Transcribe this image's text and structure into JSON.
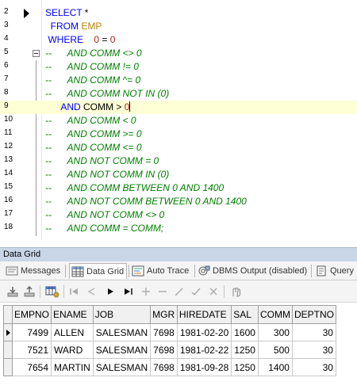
{
  "editor": {
    "current_line": 9,
    "lines": [
      {
        "n": "2",
        "tokens": [
          {
            "t": "SELECT",
            "c": "kw"
          },
          {
            "t": " *",
            "c": "id"
          }
        ]
      },
      {
        "n": "3",
        "tokens": [
          {
            "t": "  FROM ",
            "c": "kw"
          },
          {
            "t": "EMP",
            "c": "tbl"
          }
        ]
      },
      {
        "n": "4",
        "tokens": [
          {
            "t": " WHERE",
            "c": "kw"
          },
          {
            "t": "    ",
            "c": "id"
          },
          {
            "t": "0",
            "c": "num"
          },
          {
            "t": " = ",
            "c": "id"
          },
          {
            "t": "0",
            "c": "num"
          }
        ]
      },
      {
        "n": "5",
        "tokens": [
          {
            "t": "--      AND COMM <> 0",
            "c": "cm"
          }
        ]
      },
      {
        "n": "6",
        "tokens": [
          {
            "t": "--      AND COMM != 0",
            "c": "cm"
          }
        ]
      },
      {
        "n": "7",
        "tokens": [
          {
            "t": "--      AND COMM ^= 0",
            "c": "cm"
          }
        ]
      },
      {
        "n": "8",
        "tokens": [
          {
            "t": "--      AND COMM NOT IN (0)",
            "c": "cm"
          }
        ]
      },
      {
        "n": "9",
        "tokens": [
          {
            "t": "      AND ",
            "c": "kw"
          },
          {
            "t": "COMM > ",
            "c": "id"
          },
          {
            "t": "0",
            "c": "num"
          }
        ]
      },
      {
        "n": "10",
        "tokens": [
          {
            "t": "--      AND COMM < 0",
            "c": "cm"
          }
        ]
      },
      {
        "n": "11",
        "tokens": [
          {
            "t": "--      AND COMM >= 0",
            "c": "cm"
          }
        ]
      },
      {
        "n": "12",
        "tokens": [
          {
            "t": "--      AND COMM <= 0",
            "c": "cm"
          }
        ]
      },
      {
        "n": "13",
        "tokens": [
          {
            "t": "--      AND NOT COMM = 0",
            "c": "cm"
          }
        ]
      },
      {
        "n": "14",
        "tokens": [
          {
            "t": "--      AND NOT COMM IN (0)",
            "c": "cm"
          }
        ]
      },
      {
        "n": "15",
        "tokens": [
          {
            "t": "--      AND COMM BETWEEN 0 AND 1400",
            "c": "cm"
          }
        ]
      },
      {
        "n": "16",
        "tokens": [
          {
            "t": "--      AND NOT COMM BETWEEN 0 AND 1400",
            "c": "cm"
          }
        ]
      },
      {
        "n": "17",
        "tokens": [
          {
            "t": "--      AND NOT COMM <> 0",
            "c": "cm"
          }
        ]
      },
      {
        "n": "18",
        "tokens": [
          {
            "t": "--      AND COMM = COMM;",
            "c": "cm"
          }
        ]
      }
    ]
  },
  "panel": {
    "title": "Data Grid"
  },
  "tabs": [
    {
      "label": "Messages",
      "icon": "messages-icon",
      "active": false
    },
    {
      "label": "Data Grid",
      "icon": "data-grid-icon",
      "active": true
    },
    {
      "label": "Auto Trace",
      "icon": "auto-trace-icon",
      "active": false
    },
    {
      "label": "DBMS Output (disabled)",
      "icon": "dbms-output-icon",
      "active": false
    },
    {
      "label": "Query",
      "icon": "query-icon",
      "active": false
    }
  ],
  "toolbar": {
    "buttons": [
      "import-icon",
      "export-icon",
      "grid-options-icon",
      "first-record-icon",
      "prior-record-icon",
      "next-record-icon",
      "last-record-icon",
      "insert-record-icon",
      "delete-record-icon",
      "edit-record-icon",
      "post-edit-icon",
      "cancel-edit-icon",
      "refresh-icon"
    ]
  },
  "grid": {
    "columns": [
      "EMPNO",
      "ENAME",
      "JOB",
      "MGR",
      "HIREDATE",
      "SAL",
      "COMM",
      "DEPTNO"
    ],
    "numeric_columns": [
      0,
      3,
      5,
      6,
      7
    ],
    "rows": [
      [
        "7499",
        "ALLEN",
        "SALESMAN",
        "7698",
        "1981-02-20",
        "1600",
        "300",
        "30"
      ],
      [
        "7521",
        "WARD",
        "SALESMAN",
        "7698",
        "1981-02-22",
        "1250",
        "500",
        "30"
      ],
      [
        "7654",
        "MARTIN",
        "SALESMAN",
        "7698",
        "1981-09-28",
        "1250",
        "1400",
        "30"
      ]
    ],
    "current_row": 0
  },
  "colors": {
    "keyword": "#0000ff",
    "comment": "#008000",
    "table": "#b8860b",
    "number": "#b22222",
    "panel_title_bg": "#c9d6e8",
    "current_line_bg": "#ffffd6"
  }
}
